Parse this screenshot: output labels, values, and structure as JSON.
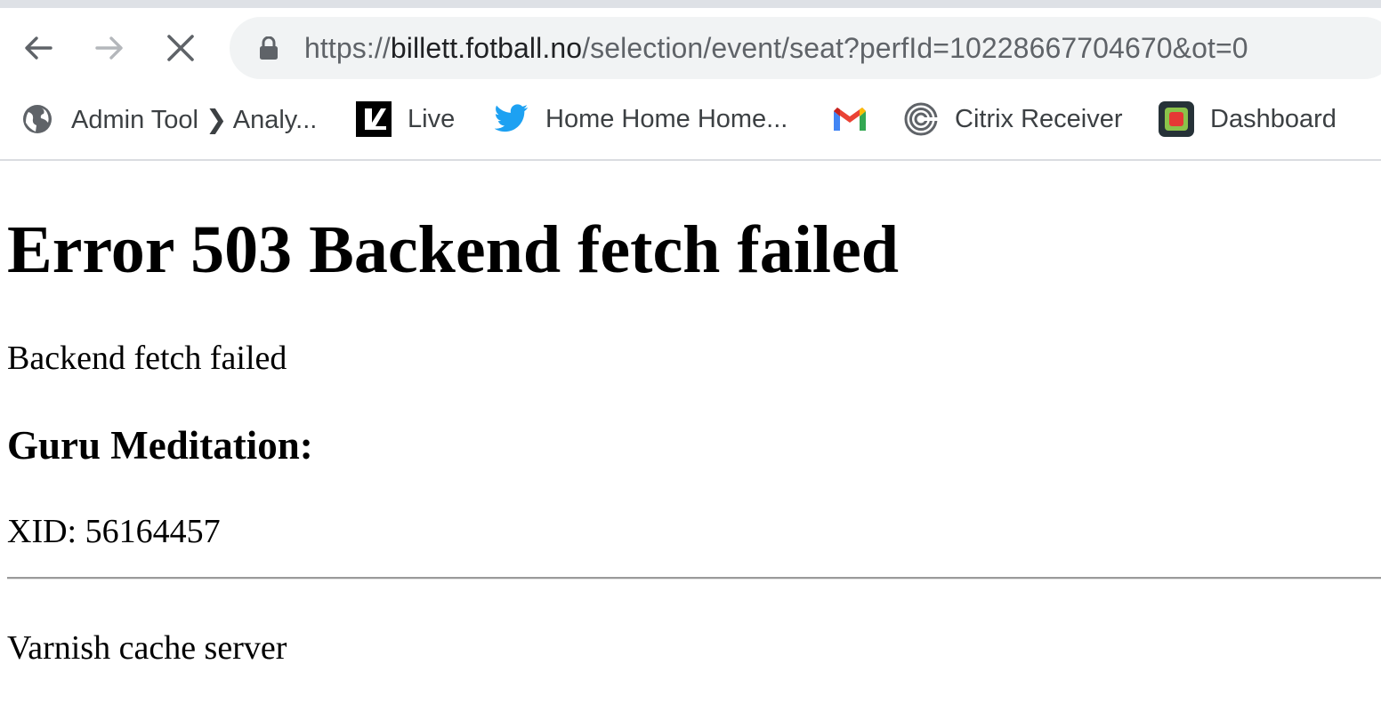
{
  "browser": {
    "url_scheme": "https://",
    "url_host": "billett.fotball.no",
    "url_path": "/selection/event/seat?perfId=10228667704670&ot=0"
  },
  "bookmarks": [
    {
      "label": "Admin Tool ❯ Analy...",
      "icon": "globe-icon"
    },
    {
      "label": "Live",
      "icon": "live-logo-icon"
    },
    {
      "label": "Home Home Home...",
      "icon": "twitter-bird-icon"
    },
    {
      "label": "",
      "icon": "gmail-icon"
    },
    {
      "label": "Citrix Receiver",
      "icon": "citrix-icon"
    },
    {
      "label": "Dashboard",
      "icon": "dashboard-icon"
    }
  ],
  "page": {
    "heading": "Error 503 Backend fetch failed",
    "message": "Backend fetch failed",
    "subheading": "Guru Meditation:",
    "xid": "XID: 56164457",
    "footer": "Varnish cache server"
  },
  "colors": {
    "chrome_strip": "#dee1e6",
    "omnibox_bg": "#f1f3f4",
    "twitter_blue": "#1da1f2"
  }
}
